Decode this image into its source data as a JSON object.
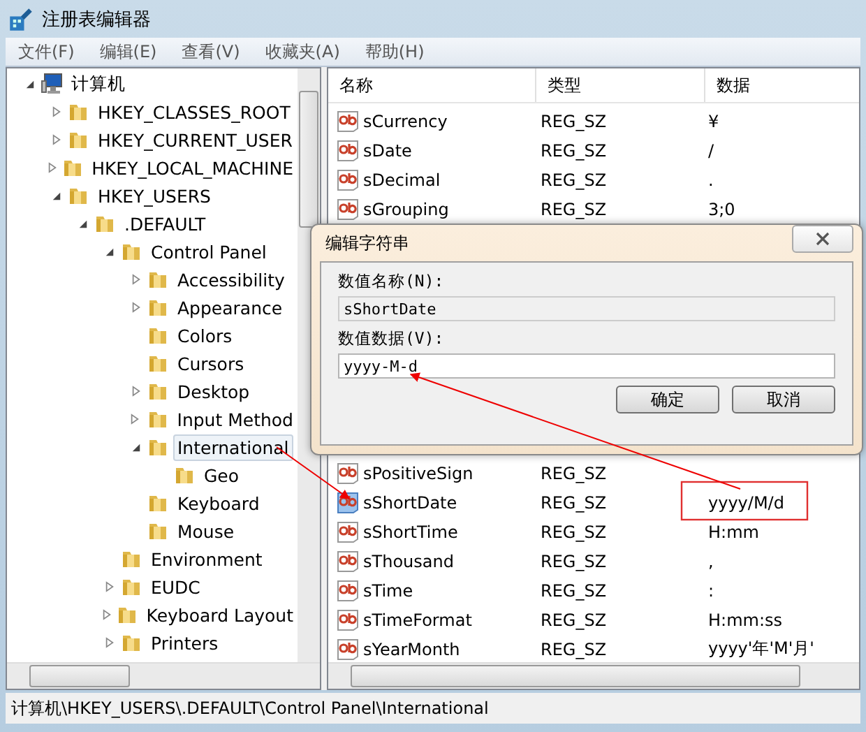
{
  "window": {
    "title": "注册表编辑器"
  },
  "menu": [
    "文件(F)",
    "编辑(E)",
    "查看(V)",
    "收藏夹(A)",
    "帮助(H)"
  ],
  "tree": [
    {
      "label": "计算机",
      "kind": "computer",
      "expanded": true,
      "selected": false,
      "children": [
        {
          "label": "HKEY_CLASSES_ROOT",
          "kind": "folder",
          "expanded": false,
          "selected": false
        },
        {
          "label": "HKEY_CURRENT_USER",
          "kind": "folder",
          "expanded": false,
          "selected": false
        },
        {
          "label": "HKEY_LOCAL_MACHINE",
          "kind": "folder",
          "expanded": false,
          "selected": false
        },
        {
          "label": "HKEY_USERS",
          "kind": "folder",
          "expanded": true,
          "selected": false,
          "children": [
            {
              "label": ".DEFAULT",
              "kind": "folder",
              "expanded": true,
              "selected": false,
              "children": [
                {
                  "label": "Control Panel",
                  "kind": "folder",
                  "expanded": true,
                  "selected": false,
                  "children": [
                    {
                      "label": "Accessibility",
                      "kind": "folder",
                      "expanded": false,
                      "selected": false
                    },
                    {
                      "label": "Appearance",
                      "kind": "folder",
                      "expanded": false,
                      "selected": false
                    },
                    {
                      "label": "Colors",
                      "kind": "folder",
                      "selected": false
                    },
                    {
                      "label": "Cursors",
                      "kind": "folder",
                      "selected": false
                    },
                    {
                      "label": "Desktop",
                      "kind": "folder",
                      "expanded": false,
                      "selected": false
                    },
                    {
                      "label": "Input Method",
                      "kind": "folder",
                      "expanded": false,
                      "selected": false
                    },
                    {
                      "label": "International",
                      "kind": "folder",
                      "expanded": true,
                      "selected": true,
                      "children": [
                        {
                          "label": "Geo",
                          "kind": "folder",
                          "selected": false
                        }
                      ]
                    },
                    {
                      "label": "Keyboard",
                      "kind": "folder",
                      "selected": false
                    },
                    {
                      "label": "Mouse",
                      "kind": "folder",
                      "selected": false
                    }
                  ]
                },
                {
                  "label": "Environment",
                  "kind": "folder",
                  "selected": false
                },
                {
                  "label": "EUDC",
                  "kind": "folder",
                  "expanded": false,
                  "selected": false
                },
                {
                  "label": "Keyboard Layout",
                  "kind": "folder",
                  "expanded": false,
                  "selected": false
                },
                {
                  "label": "Printers",
                  "kind": "folder",
                  "expanded": false,
                  "selected": false
                }
              ]
            }
          ]
        }
      ]
    }
  ],
  "list": {
    "columns": [
      "名称",
      "类型",
      "数据"
    ],
    "rows_above_dialog": [
      {
        "name": "sCurrency",
        "type": "REG_SZ",
        "data": "¥",
        "selected": false
      },
      {
        "name": "sDate",
        "type": "REG_SZ",
        "data": "/",
        "selected": false
      },
      {
        "name": "sDecimal",
        "type": "REG_SZ",
        "data": ".",
        "selected": false
      },
      {
        "name": "sGrouping",
        "type": "REG_SZ",
        "data": "3;0",
        "selected": false
      }
    ],
    "rows_below_dialog": [
      {
        "name": "sPositiveSign",
        "type": "REG_SZ",
        "selected": false
      },
      {
        "name": "sShortDate",
        "type": "REG_SZ",
        "data": "yyyy/M/d",
        "selected": true
      },
      {
        "name": "sShortTime",
        "type": "REG_SZ",
        "data": "H:mm",
        "selected": false
      },
      {
        "name": "sThousand",
        "type": "REG_SZ",
        "data": ",",
        "selected": false
      },
      {
        "name": "sTime",
        "type": "REG_SZ",
        "data": ":",
        "selected": false
      },
      {
        "name": "sTimeFormat",
        "type": "REG_SZ",
        "data": "H:mm:ss",
        "selected": false
      },
      {
        "name": "sYearMonth",
        "type": "REG_SZ",
        "data": "yyyy'年'M'月'",
        "selected": false
      }
    ]
  },
  "dialog": {
    "title": "编辑字符串",
    "name_label": "数值名称(N):",
    "name_value": "sShortDate",
    "data_label": "数值数据(V):",
    "data_value": "yyyy-M-d",
    "buttons": [
      "确定",
      "取消"
    ]
  },
  "status_bar": "计算机\\HKEY_USERS\\.DEFAULT\\Control Panel\\International"
}
